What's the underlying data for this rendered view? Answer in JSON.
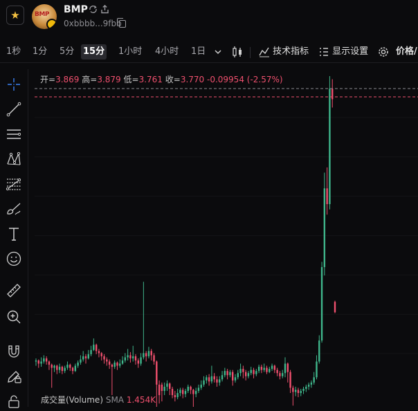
{
  "header": {
    "token_name": "BMP",
    "address": "0xbbbb...9fbb",
    "avatar_text": "BMP"
  },
  "toolbar": {
    "timeframes": [
      "1秒",
      "1分",
      "5分",
      "15分",
      "1小时",
      "4小时",
      "1日"
    ],
    "active_timeframe": "15分",
    "indicators_label": "技术指标",
    "display_settings_label": "显示设置",
    "price_label": "价格/"
  },
  "ohlc": {
    "open_label": "开=",
    "open": "3.869",
    "high_label": "高=",
    "high": "3.879",
    "low_label": "低=",
    "low": "3.761",
    "close_label": "收=",
    "close": "3.770",
    "change": "-0.09954 (-2.57%)"
  },
  "volume": {
    "label": "成交量(Volume)",
    "sma_label": "SMA",
    "value": "1.454K"
  },
  "colors": {
    "up": "#3fb68b",
    "down": "#f0506e",
    "favorite": "#f5c242",
    "accent": "#3b82f6"
  },
  "chart_data": {
    "type": "candlestick",
    "price_scale": [
      3.0,
      6.0
    ],
    "y_labels_visible": false,
    "last_price_line": 3.77,
    "high_price_line": 3.879,
    "candles": [
      [
        3.3,
        3.31,
        3.26,
        3.33
      ],
      [
        3.31,
        3.28,
        3.24,
        3.32
      ],
      [
        3.28,
        3.3,
        3.25,
        3.34
      ],
      [
        3.3,
        3.33,
        3.28,
        3.36
      ],
      [
        3.33,
        3.3,
        3.27,
        3.35
      ],
      [
        3.3,
        3.27,
        3.22,
        3.31
      ],
      [
        3.27,
        3.24,
        3.05,
        3.28
      ],
      [
        3.24,
        3.26,
        3.2,
        3.27
      ],
      [
        3.26,
        3.22,
        3.18,
        3.27
      ],
      [
        3.22,
        3.25,
        3.19,
        3.28
      ],
      [
        3.25,
        3.21,
        3.18,
        3.26
      ],
      [
        3.21,
        3.24,
        3.19,
        3.26
      ],
      [
        3.24,
        3.27,
        3.22,
        3.3
      ],
      [
        3.27,
        3.24,
        3.21,
        3.28
      ],
      [
        3.24,
        3.21,
        3.18,
        3.25
      ],
      [
        3.21,
        3.26,
        3.2,
        3.28
      ],
      [
        3.26,
        3.29,
        3.24,
        3.31
      ],
      [
        3.29,
        3.32,
        3.27,
        3.36
      ],
      [
        3.32,
        3.35,
        3.3,
        3.4
      ],
      [
        3.35,
        3.33,
        3.28,
        3.37
      ],
      [
        3.33,
        3.37,
        3.32,
        3.41
      ],
      [
        3.37,
        3.41,
        3.35,
        3.45
      ],
      [
        3.41,
        3.46,
        3.4,
        3.52
      ],
      [
        3.46,
        3.4,
        3.37,
        3.47
      ],
      [
        3.4,
        3.38,
        3.34,
        3.42
      ],
      [
        3.38,
        3.35,
        3.31,
        3.39
      ],
      [
        3.35,
        3.32,
        3.28,
        3.37
      ],
      [
        3.32,
        3.3,
        3.26,
        3.34
      ],
      [
        3.3,
        3.27,
        3.23,
        3.32
      ],
      [
        3.27,
        3.25,
        2.98,
        3.28
      ],
      [
        3.25,
        3.29,
        3.23,
        3.31
      ],
      [
        3.29,
        3.26,
        3.22,
        3.3
      ],
      [
        3.26,
        3.28,
        3.24,
        3.32
      ],
      [
        3.28,
        3.31,
        3.27,
        3.35
      ],
      [
        3.31,
        3.34,
        3.29,
        3.38
      ],
      [
        3.34,
        3.36,
        3.31,
        3.42
      ],
      [
        3.36,
        3.33,
        3.29,
        3.39
      ],
      [
        3.33,
        3.35,
        3.3,
        3.45
      ],
      [
        3.35,
        3.31,
        3.27,
        3.37
      ],
      [
        3.31,
        3.28,
        3.24,
        3.33
      ],
      [
        3.28,
        3.34,
        3.26,
        3.38
      ],
      [
        3.34,
        3.38,
        3.32,
        4.06
      ],
      [
        3.38,
        3.35,
        3.3,
        3.4
      ],
      [
        3.35,
        3.4,
        3.33,
        3.44
      ],
      [
        3.4,
        3.36,
        3.31,
        3.42
      ],
      [
        3.36,
        3.3,
        3.27,
        3.38
      ],
      [
        3.3,
        3.08,
        2.68,
        3.31
      ],
      [
        3.08,
        2.98,
        2.9,
        3.12
      ],
      [
        3.08,
        3.02,
        2.92,
        3.1
      ],
      [
        3.02,
        3.06,
        2.98,
        3.1
      ],
      [
        3.06,
        3.09,
        3.02,
        3.12
      ],
      [
        3.09,
        3.04,
        2.98,
        3.1
      ],
      [
        3.04,
        2.98,
        2.95,
        3.06
      ],
      [
        2.98,
        2.96,
        2.92,
        3.02
      ],
      [
        2.96,
        3.0,
        2.94,
        3.04
      ],
      [
        3.0,
        3.03,
        2.97,
        3.05
      ],
      [
        3.03,
        2.99,
        2.95,
        3.05
      ],
      [
        2.99,
        3.02,
        2.96,
        3.04
      ],
      [
        3.02,
        3.06,
        3.0,
        3.08
      ],
      [
        3.06,
        3.03,
        2.99,
        3.07
      ],
      [
        3.03,
        2.99,
        2.72,
        3.04
      ],
      [
        2.99,
        3.02,
        2.96,
        3.05
      ],
      [
        3.02,
        3.05,
        3.0,
        3.08
      ],
      [
        3.05,
        3.08,
        3.03,
        3.12
      ],
      [
        3.08,
        3.12,
        3.06,
        3.16
      ],
      [
        3.12,
        3.15,
        3.09,
        3.17
      ],
      [
        3.15,
        3.11,
        3.07,
        3.18
      ],
      [
        3.11,
        3.16,
        3.09,
        3.26
      ],
      [
        3.16,
        3.13,
        3.1,
        3.19
      ],
      [
        3.13,
        3.1,
        3.06,
        3.16
      ],
      [
        3.1,
        3.13,
        3.07,
        3.16
      ],
      [
        3.13,
        3.17,
        3.11,
        3.21
      ],
      [
        3.17,
        3.21,
        3.15,
        3.24
      ],
      [
        3.21,
        3.17,
        3.13,
        3.23
      ],
      [
        3.17,
        3.2,
        3.15,
        3.22
      ],
      [
        3.2,
        3.12,
        3.07,
        3.22
      ],
      [
        3.12,
        3.15,
        3.1,
        3.18
      ],
      [
        3.15,
        3.19,
        3.13,
        3.22
      ],
      [
        3.19,
        3.23,
        3.16,
        3.28
      ],
      [
        3.23,
        3.2,
        3.14,
        3.26
      ],
      [
        3.2,
        3.16,
        3.12,
        3.22
      ],
      [
        3.16,
        3.19,
        3.14,
        3.21
      ],
      [
        3.19,
        3.22,
        3.17,
        3.25
      ],
      [
        3.22,
        3.18,
        3.14,
        3.24
      ],
      [
        3.18,
        3.21,
        3.16,
        3.23
      ],
      [
        3.21,
        3.25,
        3.19,
        3.27
      ],
      [
        3.25,
        3.22,
        3.19,
        3.27
      ],
      [
        3.22,
        3.24,
        3.2,
        3.28
      ],
      [
        3.24,
        3.2,
        3.18,
        3.26
      ],
      [
        3.2,
        3.23,
        3.19,
        3.25
      ],
      [
        3.23,
        3.26,
        3.21,
        3.28
      ],
      [
        3.26,
        3.22,
        3.19,
        3.27
      ],
      [
        3.22,
        3.19,
        3.16,
        3.24
      ],
      [
        3.19,
        3.16,
        3.13,
        3.21
      ],
      [
        3.16,
        3.19,
        3.14,
        3.22
      ],
      [
        3.19,
        3.28,
        3.15,
        3.34
      ],
      [
        3.28,
        3.2,
        3.1,
        3.29
      ],
      [
        3.2,
        3.05,
        3.0,
        3.22
      ],
      [
        3.05,
        3.01,
        2.88,
        3.07
      ],
      [
        3.01,
        3.03,
        2.97,
        3.06
      ],
      [
        3.03,
        3.0,
        2.96,
        3.05
      ],
      [
        3.0,
        3.02,
        2.97,
        3.04
      ],
      [
        3.02,
        3.04,
        2.99,
        3.06
      ],
      [
        3.04,
        3.06,
        3.01,
        3.08
      ],
      [
        3.06,
        3.08,
        3.03,
        3.1
      ],
      [
        3.08,
        3.1,
        3.05,
        3.12
      ],
      [
        3.1,
        3.15,
        3.08,
        3.2
      ],
      [
        3.15,
        3.3,
        3.13,
        3.36
      ],
      [
        3.3,
        3.5,
        3.28,
        3.55
      ],
      [
        3.5,
        4.2,
        3.48,
        4.25
      ],
      [
        4.2,
        4.95,
        4.12,
        5.1
      ],
      [
        4.95,
        4.8,
        4.7,
        5.15
      ],
      [
        4.8,
        5.9,
        4.75,
        6.02
      ],
      [
        5.9,
        5.8,
        5.72,
        5.99
      ],
      [
        3.869,
        3.77,
        3.761,
        3.879
      ]
    ]
  }
}
